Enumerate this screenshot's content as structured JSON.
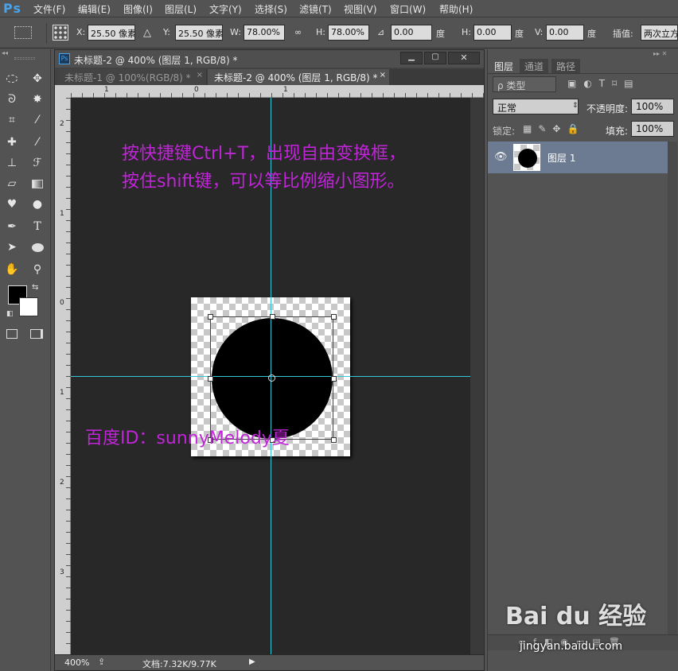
{
  "app": {
    "logo": "Ps"
  },
  "menu": [
    "文件(F)",
    "编辑(E)",
    "图像(I)",
    "图层(L)",
    "文字(Y)",
    "选择(S)",
    "滤镜(T)",
    "视图(V)",
    "窗口(W)",
    "帮助(H)"
  ],
  "options": {
    "x_label": "X:",
    "x_value": "25.50 像素",
    "y_label": "Y:",
    "y_value": "25.50 像素",
    "w_label": "W:",
    "w_value": "78.00%",
    "h_label": "H:",
    "h_value": "78.00%",
    "angle_value": "0.00",
    "angle_unit": "度",
    "hskew_label": "H:",
    "hskew_value": "0.00",
    "hskew_unit": "度",
    "vskew_label": "V:",
    "vskew_value": "0.00",
    "vskew_unit": "度",
    "interp_label": "插值:",
    "interp_value": "两次立方"
  },
  "document": {
    "title": "未标题-2 @ 400% (图层 1, RGB/8) *",
    "tabs": [
      "未标题-1 @ 100%(RGB/8) *",
      "未标题-2 @ 400% (图层 1, RGB/8) *"
    ],
    "ruler_top": [
      "1",
      "0",
      "1"
    ],
    "ruler_left": [
      "2",
      "1",
      "0",
      "1",
      "2",
      "3"
    ],
    "zoom": "400%",
    "doc_size": "文档:7.32K/9.77K"
  },
  "captions": {
    "line1": "按快捷键Ctrl+T，出现自由变换框，",
    "line2": "按住shift键，可以等比例缩小图形。",
    "credit": "百度ID：sunnyMelody夏"
  },
  "panel": {
    "tabs": [
      "图层",
      "通道",
      "路径"
    ],
    "filter_kind": "ρ 类型",
    "blend_mode": "正常",
    "opacity_label": "不透明度:",
    "opacity_value": "100%",
    "lock_label": "锁定:",
    "fill_label": "填充:",
    "fill_value": "100%",
    "layer_name": "图层 1"
  },
  "watermark": {
    "brand": "Bai du 经验",
    "url": "jingyan.baidu.com"
  },
  "colors": {
    "guide": "#33c8d8",
    "caption": "#c025d8",
    "selected_layer": "#6d7b92"
  }
}
